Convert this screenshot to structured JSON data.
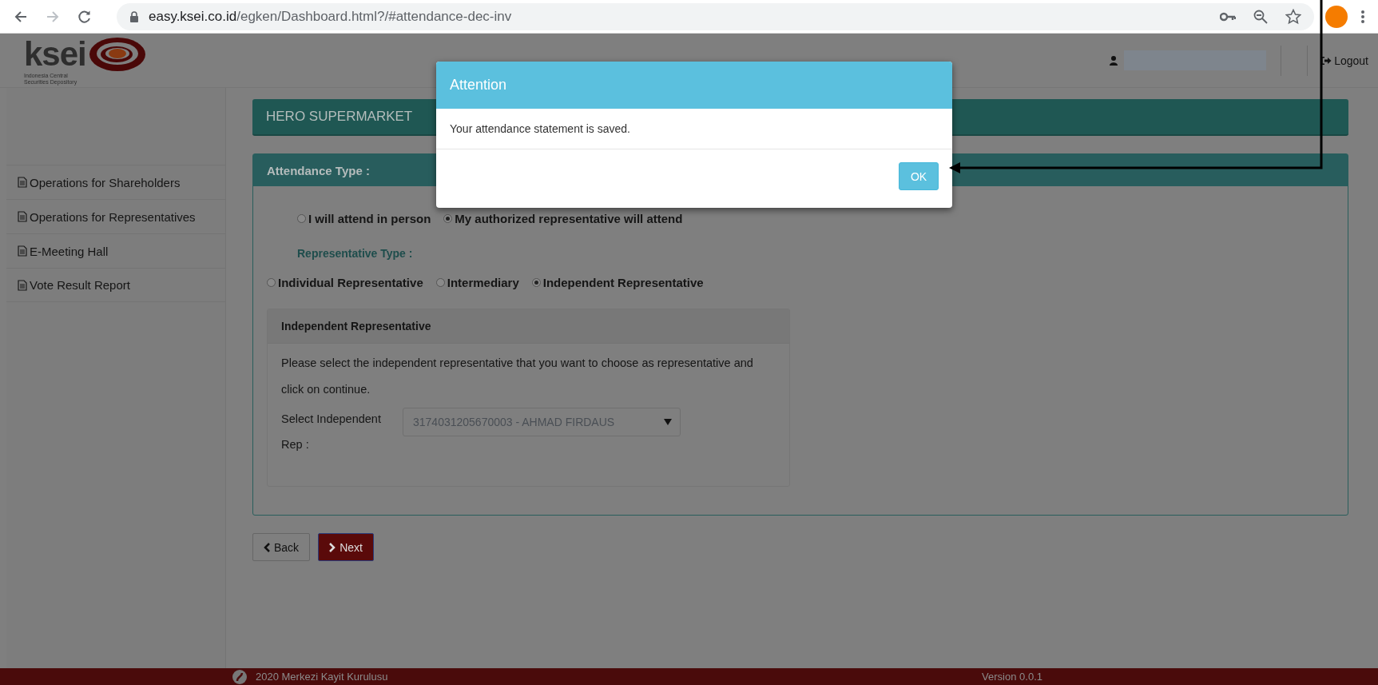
{
  "browser": {
    "url_host": "easy.ksei.co.id",
    "url_path": "/egken/Dashboard.html?/#attendance-dec-inv"
  },
  "header": {
    "logo_text": "ksei",
    "logo_tagline": "Indonesia Central Securities Depository",
    "logout": "Logout"
  },
  "sidebar": {
    "items": [
      {
        "label": "Operations for Shareholders"
      },
      {
        "label": "Operations for Representatives"
      },
      {
        "label": "E-Meeting Hall"
      },
      {
        "label": "Vote Result Report"
      }
    ]
  },
  "title": "HERO SUPERMARKET",
  "panel": {
    "title": "Attendance Type :",
    "attendance_options": [
      {
        "label": "I will attend in person",
        "selected": false
      },
      {
        "label": "My authorized representative will attend",
        "selected": true
      }
    ],
    "representative_type_label": "Representative Type :",
    "representative_options": [
      {
        "label": "Individual Representative",
        "selected": false
      },
      {
        "label": "Intermediary",
        "selected": false
      },
      {
        "label": "Independent Representative",
        "selected": true
      }
    ],
    "subpanel": {
      "title": "Independent Representative",
      "text": "Please select the independent representative that you want to choose as representative and click on continue.",
      "select_label": "Select Independent Rep :",
      "select_value": "3174031205670003 - AHMAD FIRDAUS"
    }
  },
  "buttons": [
    {
      "kind": "back",
      "label": "Back"
    },
    {
      "kind": "next",
      "label": "Next"
    }
  ],
  "footer": {
    "text": "2020 Merkezi Kayit Kurulusu",
    "version": "Version 0.0.1"
  },
  "modal": {
    "title": "Attention",
    "message": "Your attendance statement is saved.",
    "button": "OK"
  }
}
